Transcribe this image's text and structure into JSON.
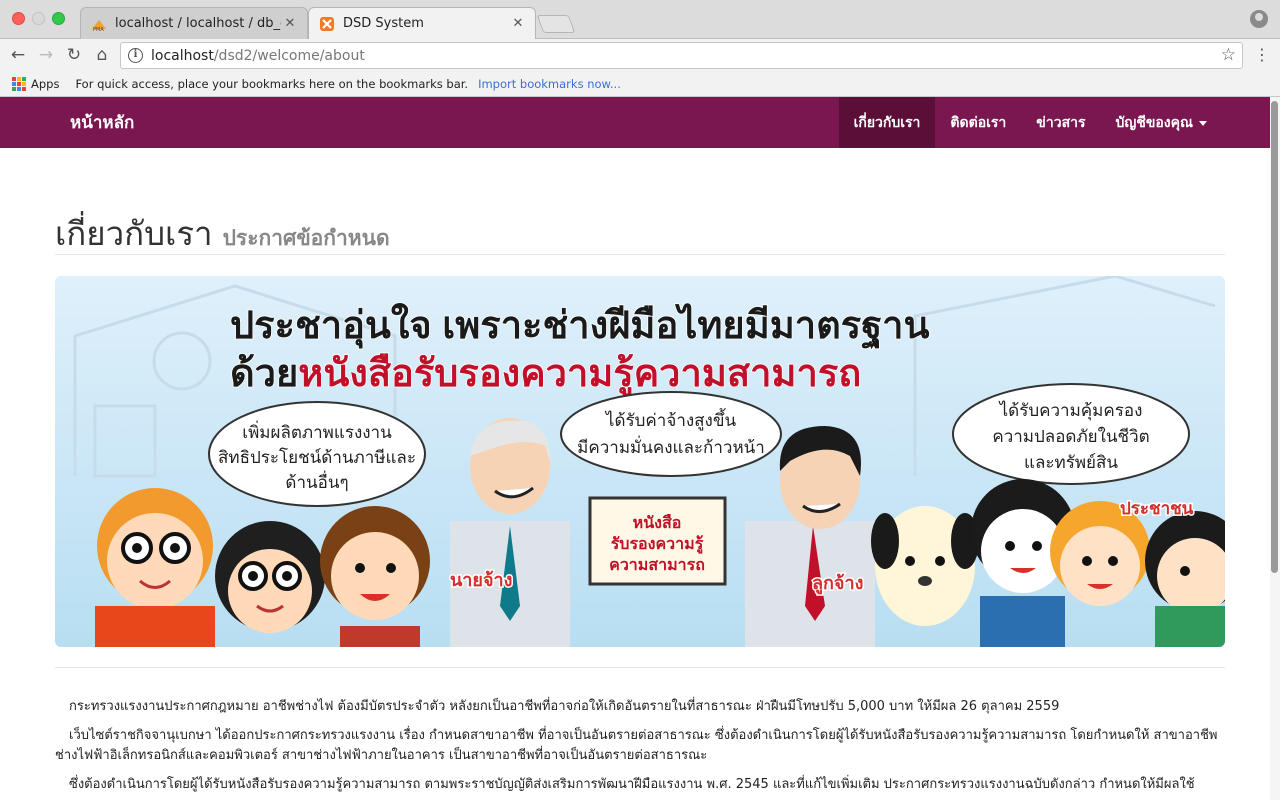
{
  "browser": {
    "tabs": [
      {
        "title": "localhost / localhost / db_dsd",
        "active": false
      },
      {
        "title": "DSD System",
        "active": true
      }
    ],
    "tab_close": "✕",
    "url_host": "localhost",
    "url_path": "/dsd2/welcome/about",
    "bookmarks_bar": {
      "apps_label": "Apps",
      "hint": "For quick access, place your bookmarks here on the bookmarks bar.",
      "import_link": "Import bookmarks now..."
    }
  },
  "navbar": {
    "brand": "หน้าหลัก",
    "links": [
      {
        "label": "เกี่ยวกับเรา",
        "active": true
      },
      {
        "label": "ติดต่อเรา",
        "active": false
      },
      {
        "label": "ข่าวสาร",
        "active": false
      },
      {
        "label": "บัญชีของคุณ",
        "active": false,
        "dropdown": true
      }
    ]
  },
  "page": {
    "title": "เกี่ยวกับเรา",
    "subtitle": "ประกาศข้อกำหนด",
    "banner": {
      "headline_1": "ประชาอุ่นใจ เพราะช่างฝีมือไทยมีมาตรฐาน",
      "headline_2_prefix": "ด้วย",
      "headline_2_emph": "หนังสือรับรองความรู้ความสามารถ",
      "bubble_left": [
        "เพิ่มผลิตภาพแรงงาน",
        "สิทธิประโยชน์ด้านภาษีและ",
        "ด้านอื่นๆ"
      ],
      "bubble_mid": [
        "ได้รับค่าจ้างสูงขึ้น",
        "มีความมั่นคงและก้าวหน้า"
      ],
      "bubble_right": [
        "ได้รับความคุ้มครอง",
        "ความปลอดภัยในชีวิต",
        "และทรัพย์สิน"
      ],
      "certificate": [
        "หนังสือ",
        "รับรองความรู้",
        "ความสามารถ"
      ],
      "label_employer": "นายจ้าง",
      "label_employee": "ลูกจ้าง",
      "label_public": "ประชาชน"
    },
    "paragraphs": [
      "กระทรวงแรงงานประกาศกฎหมาย อาชีพช่างไฟ ต้องมีบัตรประจำตัว หลังยกเป็นอาชีพที่อาจก่อให้เกิดอันตรายในที่สาธารณะ ฝ่าฝืนมีโทษปรับ 5,000 บาท ให้มีผล 26 ตุลาคม 2559",
      "เว็บไซต์ราชกิจจานุเบกษา ได้ออกประกาศกระทรวงแรงงาน เรื่อง กำหนดสาขาอาชีพ ที่อาจเป็นอันตรายต่อสาธารณะ ซึ่งต้องดำเนินการโดยผู้ได้รับหนังสือรับรองความรู้ความสามารถ โดยกำหนดให้ สาขาอาชีพช่างไฟฟ้าอิเล็กทรอนิกส์และคอมพิวเตอร์ สาขาช่างไฟฟ้าภายในอาคาร เป็นสาขาอาชีพที่อาจเป็นอันตรายต่อสาธารณะ",
      "ซึ่งต้องดำเนินการโดยผู้ได้รับหนังสือรับรองความรู้ความสามารถ ตามพระราชบัญญัติส่งเสริมการพัฒนาฝีมือแรงงาน พ.ศ. 2545 และที่แก้ไขเพิ่มเติม ประกาศกระทรวงแรงงานฉบับดังกล่าว กำหนดให้มีผลใช้"
    ]
  },
  "colors": {
    "navbar": "#7b1750",
    "navbar_active": "#5a0e38",
    "banner_emphasis": "#c0102a"
  }
}
